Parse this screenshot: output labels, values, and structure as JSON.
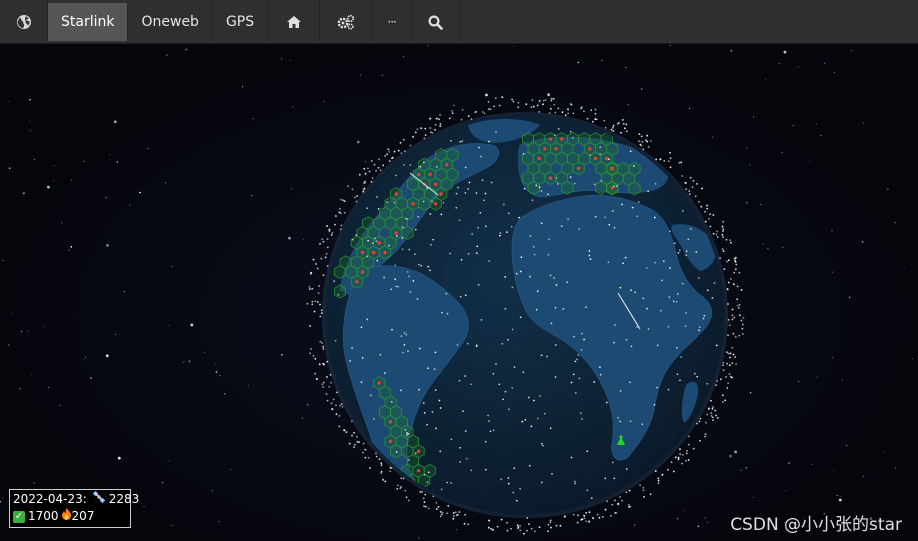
{
  "navbar": {
    "globe_icon": "globe-icon",
    "tabs": [
      {
        "label": "Starlink",
        "active": true
      },
      {
        "label": "Oneweb",
        "active": false
      },
      {
        "label": "GPS",
        "active": false
      }
    ],
    "home_icon": "home-icon",
    "settings_icon": "gears-icon",
    "more_label": "···",
    "search_icon": "search-icon"
  },
  "stats": {
    "date_label": "2022-04-23:",
    "satellite_icon": "satellite-icon",
    "total": "2283",
    "active_icon": "check-icon",
    "active": "1700",
    "reentry_icon": "fire-icon",
    "reentry": "207"
  },
  "watermark": "CSDN @小小张的star",
  "colors": {
    "navbar": "#2f2f2f",
    "active_tab": "#555555",
    "space": "#05060c",
    "ocean": "#0e2437",
    "land": "#1c4a72",
    "coverage_cells": "#1f7a2a",
    "satellites": "#ffffff",
    "alerts": "#ff3b1f",
    "ground_station": "#22dd22"
  }
}
